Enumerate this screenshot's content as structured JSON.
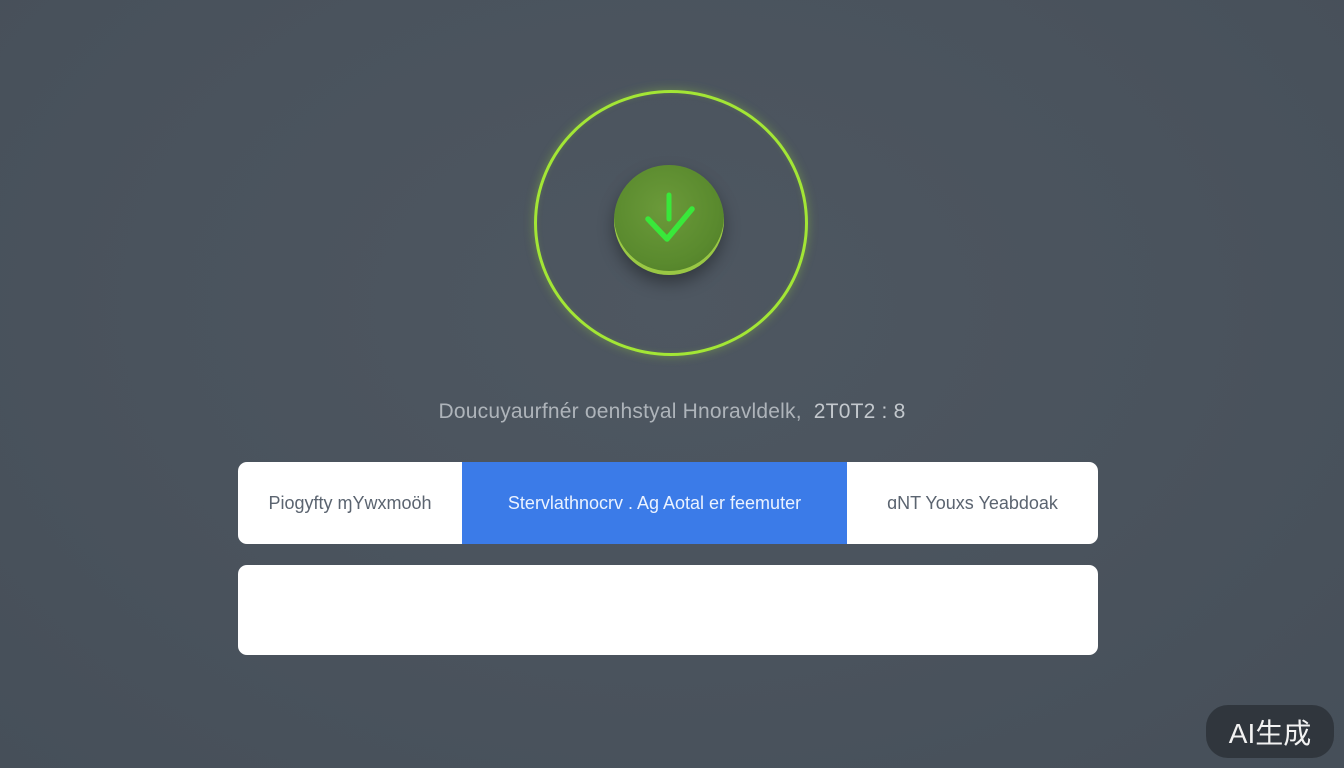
{
  "colors": {
    "accent_green": "#a3e635",
    "button_green": "#5a8a2e",
    "active_tab_blue": "#3b7be8",
    "background": "#4a535d"
  },
  "status_button": {
    "icon": "download-check-icon"
  },
  "status_line": {
    "text": "Doucuyaurfnér oenhstyal Hnoravldelk,",
    "number": "2T0T2 : 8"
  },
  "tabs": [
    {
      "label": "Piogyfty ɱYwxmoöh",
      "active": false
    },
    {
      "label": "Stervlathnocrv . Ag  Aotal er feemuter",
      "active": true
    },
    {
      "label": "ɑNT Youxs Yeabdoak",
      "active": false
    }
  ],
  "watermark": {
    "text": "AI生成"
  }
}
